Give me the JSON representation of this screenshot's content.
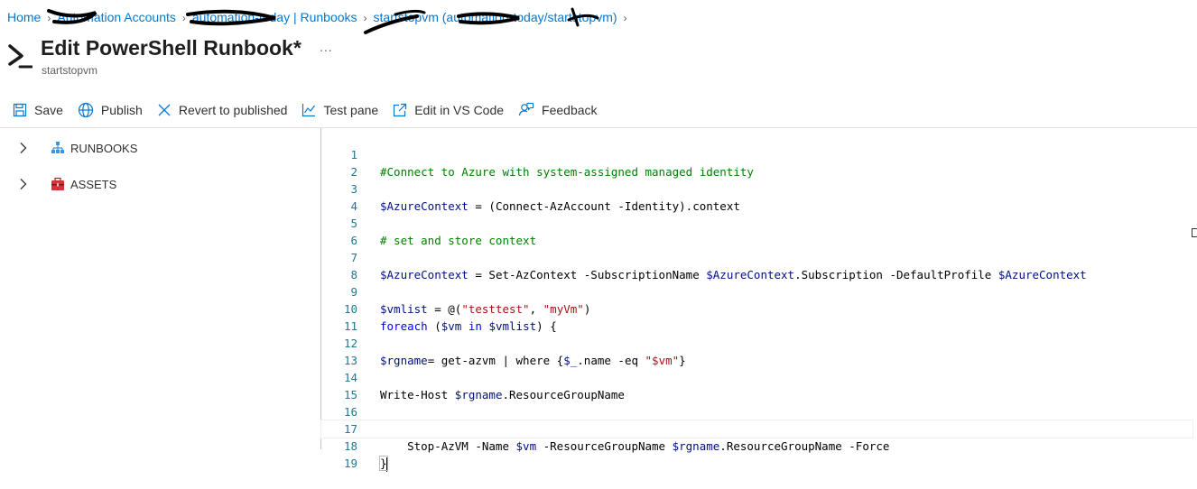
{
  "breadcrumb": {
    "items": [
      {
        "label": "Home"
      },
      {
        "label": "Automation Accounts"
      },
      {
        "label": "automation-today | Runbooks"
      },
      {
        "label": "startstopvm (automation-today/startstopvm)"
      }
    ]
  },
  "header": {
    "title": "Edit PowerShell Runbook*",
    "subtitle": "startstopvm",
    "more": "..."
  },
  "toolbar": {
    "save": "Save",
    "publish": "Publish",
    "revert": "Revert to published",
    "test_pane": "Test pane",
    "edit_vscode": "Edit in VS Code",
    "feedback": "Feedback"
  },
  "tree": {
    "runbooks": "RUNBOOKS",
    "assets": "ASSETS"
  },
  "editor": {
    "lines": [
      {
        "n": "1",
        "text": "#Connect to Azure with system-assigned managed identity"
      },
      {
        "n": "2",
        "text": ""
      },
      {
        "n": "3",
        "text": "$AzureContext = (Connect-AzAccount -Identity).context"
      },
      {
        "n": "4",
        "text": ""
      },
      {
        "n": "5",
        "text": "# set and store context"
      },
      {
        "n": "6",
        "text": ""
      },
      {
        "n": "7",
        "text": "$AzureContext = Set-AzContext -SubscriptionName $AzureContext.Subscription -DefaultProfile $AzureContext"
      },
      {
        "n": "8",
        "text": ""
      },
      {
        "n": "9",
        "text": "$vmlist = @(\"testtest\", \"myVm\")"
      },
      {
        "n": "10",
        "text": "foreach ($vm in $vmlist) {"
      },
      {
        "n": "11",
        "text": ""
      },
      {
        "n": "12",
        "text": "$rgname= get-azvm | where {$_.name -eq \"$vm\"}"
      },
      {
        "n": "13",
        "text": ""
      },
      {
        "n": "14",
        "text": "Write-Host $rgname.ResourceGroupName"
      },
      {
        "n": "15",
        "text": ""
      },
      {
        "n": "16",
        "text": ""
      },
      {
        "n": "17",
        "text": "    Stop-AzVM -Name $vm -ResourceGroupName $rgname.ResourceGroupName -Force"
      },
      {
        "n": "18",
        "text": "}"
      },
      {
        "n": "19",
        "text": ""
      }
    ]
  },
  "colors": {
    "link": "#0078d4",
    "comment": "#008000",
    "variable": "#001080",
    "string": "#a31515",
    "keyword": "#0000ff",
    "line_number": "#237893"
  },
  "icons": [
    "chevron-right-icon",
    "powershell-icon",
    "save-icon",
    "globe-icon",
    "close-icon",
    "chart-icon",
    "external-link-icon",
    "feedback-icon",
    "runbooks-icon",
    "assets-icon"
  ]
}
